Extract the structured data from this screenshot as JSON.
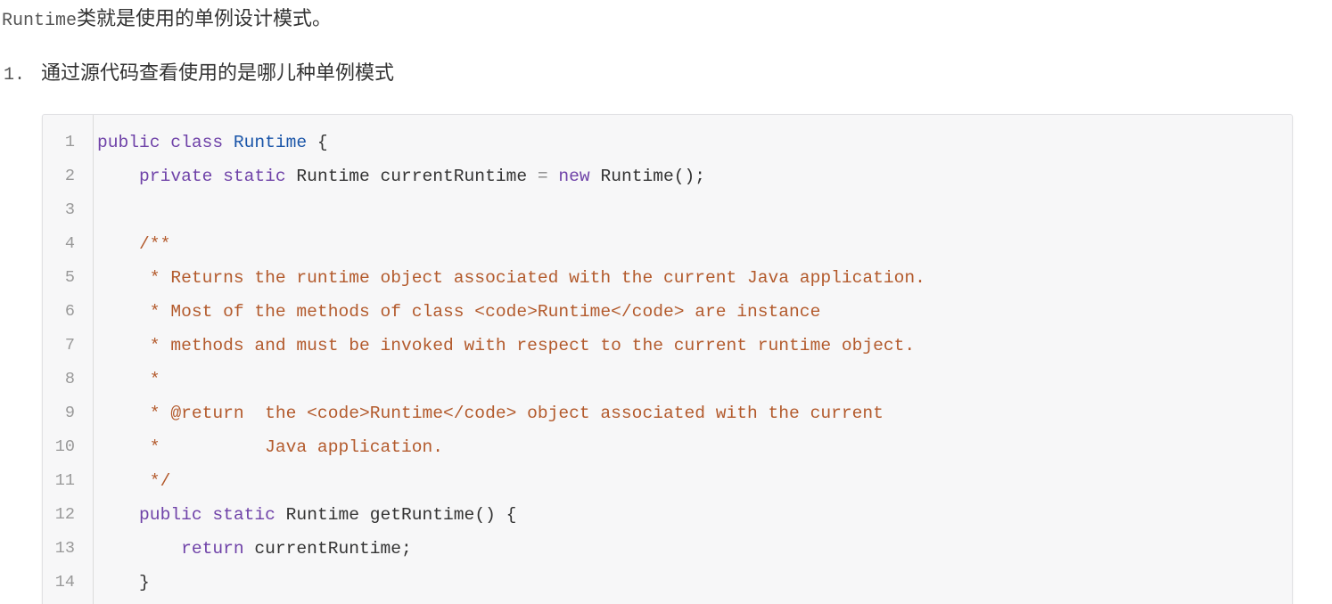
{
  "intro": {
    "code_word": "Runtime",
    "text": "类就是使用的单例设计模式。"
  },
  "list": {
    "number": "1.",
    "text": "通过源代码查看使用的是哪儿种单例模式"
  },
  "code": {
    "line_numbers": [
      "1",
      "2",
      "3",
      "4",
      "5",
      "6",
      "7",
      "8",
      "9",
      "10",
      "11",
      "12",
      "13",
      "14"
    ],
    "lines": [
      [
        [
          "kw",
          "public class "
        ],
        [
          "typ",
          "Runtime"
        ],
        [
          "pl",
          " {"
        ]
      ],
      [
        [
          "pl",
          "    "
        ],
        [
          "kw",
          "private static "
        ],
        [
          "pl",
          "Runtime currentRuntime "
        ],
        [
          "op",
          "="
        ],
        [
          "kw",
          " new "
        ],
        [
          "pl",
          "Runtime();"
        ]
      ],
      [
        [
          "pl",
          ""
        ]
      ],
      [
        [
          "pl",
          "    "
        ],
        [
          "cm",
          "/**"
        ]
      ],
      [
        [
          "pl",
          "    "
        ],
        [
          "cm",
          " * Returns the runtime object associated with the current Java application."
        ]
      ],
      [
        [
          "pl",
          "    "
        ],
        [
          "cm",
          " * Most of the methods of class <code>Runtime</code> are instance"
        ]
      ],
      [
        [
          "pl",
          "    "
        ],
        [
          "cm",
          " * methods and must be invoked with respect to the current runtime object."
        ]
      ],
      [
        [
          "pl",
          "    "
        ],
        [
          "cm",
          " *"
        ]
      ],
      [
        [
          "pl",
          "    "
        ],
        [
          "cm",
          " * @return  the <code>Runtime</code> object associated with the current"
        ]
      ],
      [
        [
          "pl",
          "    "
        ],
        [
          "cm",
          " *          Java application."
        ]
      ],
      [
        [
          "pl",
          "    "
        ],
        [
          "cm",
          " */"
        ]
      ],
      [
        [
          "pl",
          "    "
        ],
        [
          "kw",
          "public static "
        ],
        [
          "pl",
          "Runtime getRuntime() {"
        ]
      ],
      [
        [
          "pl",
          "        "
        ],
        [
          "kw",
          "return "
        ],
        [
          "pl",
          "currentRuntime;"
        ]
      ],
      [
        [
          "pl",
          "    }"
        ]
      ]
    ]
  }
}
